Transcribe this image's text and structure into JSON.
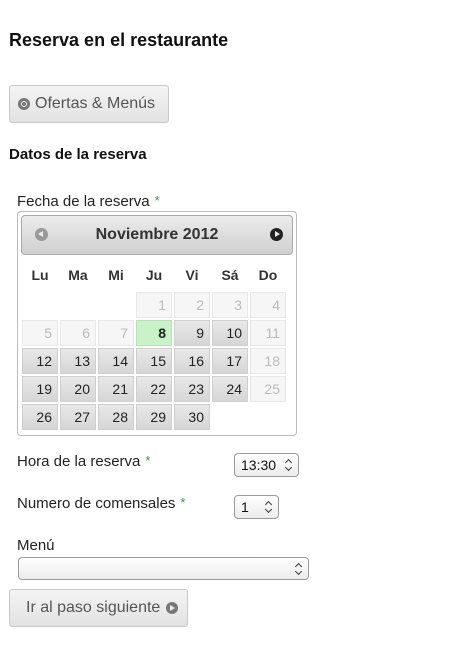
{
  "page": {
    "title": "Reserva en el restaurante"
  },
  "offers_button": {
    "label": "Ofertas & Menús",
    "icon": "search-icon"
  },
  "section": {
    "title": "Datos de la reserva"
  },
  "date_field": {
    "label": "Fecha de la reserva",
    "required_mark": "*"
  },
  "datepicker": {
    "month_title": "Noviembre 2012",
    "prev_icon": "chevron-left-icon",
    "next_icon": "chevron-right-icon",
    "weekdays": [
      "Lu",
      "Ma",
      "Mi",
      "Ju",
      "Vi",
      "Sá",
      "Do"
    ],
    "weeks": [
      [
        null,
        null,
        null,
        "1",
        "2",
        "3",
        "4"
      ],
      [
        "5",
        "6",
        "7",
        "8",
        "9",
        "10",
        "11"
      ],
      [
        "12",
        "13",
        "14",
        "15",
        "16",
        "17",
        "18"
      ],
      [
        "19",
        "20",
        "21",
        "22",
        "23",
        "24",
        "25"
      ],
      [
        "26",
        "27",
        "28",
        "29",
        "30",
        null,
        null
      ]
    ],
    "states": [
      [
        null,
        null,
        null,
        "disabled",
        "disabled",
        "disabled",
        "disabled"
      ],
      [
        "disabled",
        "disabled",
        "disabled",
        "today",
        "active",
        "active",
        "disabled"
      ],
      [
        "active",
        "active",
        "active",
        "active",
        "active",
        "active",
        "disabled"
      ],
      [
        "active",
        "active",
        "active",
        "active",
        "active",
        "active",
        "disabled"
      ],
      [
        "active",
        "active",
        "active",
        "active",
        "active",
        null,
        null
      ]
    ],
    "colors": {
      "today": "#c8f2c8",
      "required": "#2e9e3e"
    }
  },
  "time_field": {
    "label": "Hora de la reserva",
    "required_mark": "*",
    "value": "13:30"
  },
  "guests_field": {
    "label": "Numero de comensales",
    "required_mark": "*",
    "value": "1"
  },
  "menu_field": {
    "label": "Menú",
    "value": ""
  },
  "next_button": {
    "label": "Ir al paso siguiente",
    "icon": "arrow-right-icon"
  }
}
